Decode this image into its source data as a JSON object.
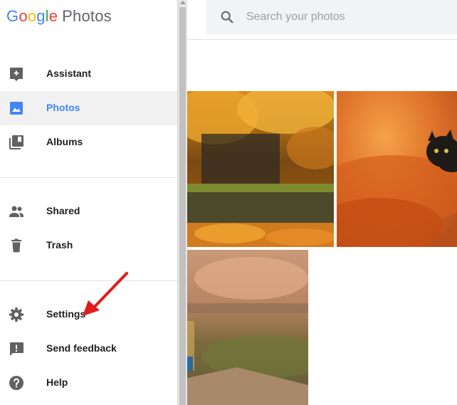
{
  "app": {
    "logo_google": [
      "G",
      "o",
      "o",
      "g",
      "l",
      "e"
    ],
    "logo_product": "Photos"
  },
  "search": {
    "placeholder": "Search your photos",
    "value": ""
  },
  "sidebar": {
    "items": [
      {
        "label": "Assistant",
        "icon": "assistant-icon",
        "active": false
      },
      {
        "label": "Photos",
        "icon": "photos-icon",
        "active": true
      },
      {
        "label": "Albums",
        "icon": "albums-icon",
        "active": false
      },
      {
        "label": "Shared",
        "icon": "shared-icon",
        "active": false
      },
      {
        "label": "Trash",
        "icon": "trash-icon",
        "active": false
      },
      {
        "label": "Settings",
        "icon": "settings-icon",
        "active": false
      },
      {
        "label": "Send feedback",
        "icon": "feedback-icon",
        "active": false
      },
      {
        "label": "Help",
        "icon": "help-icon",
        "active": false
      }
    ]
  },
  "photos": [
    {
      "name": "autumn-wall-photo"
    },
    {
      "name": "cat-in-leaves-photo"
    },
    {
      "name": "country-road-photo"
    }
  ],
  "colors": {
    "accent": "#4285f4",
    "icon": "#616161",
    "annotation": "#e31b1b",
    "active_bg": "#f1f1f1"
  }
}
